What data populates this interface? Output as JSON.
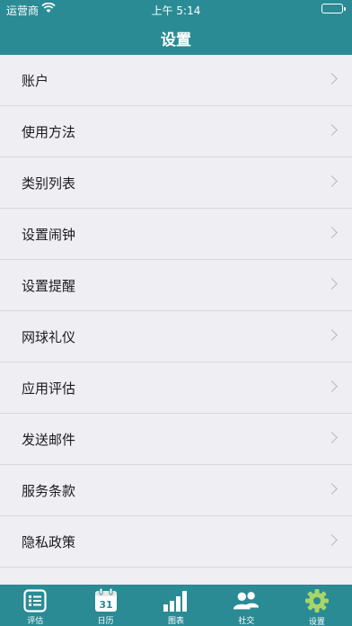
{
  "status_bar": {
    "carrier": "运营商",
    "time": "上午 5:14"
  },
  "nav": {
    "title": "设置"
  },
  "settings_items": [
    {
      "label": "账户"
    },
    {
      "label": "使用方法"
    },
    {
      "label": "类别列表"
    },
    {
      "label": "设置闹钟"
    },
    {
      "label": "设置提醒"
    },
    {
      "label": "网球礼仪"
    },
    {
      "label": "应用评估"
    },
    {
      "label": "发送邮件"
    },
    {
      "label": "服务条款"
    },
    {
      "label": "隐私政策"
    }
  ],
  "tab_bar": {
    "items": [
      {
        "label": "评估",
        "icon": "list-icon"
      },
      {
        "label": "日历",
        "icon": "calendar-icon",
        "calendar_day": "31"
      },
      {
        "label": "图表",
        "icon": "bar-chart-icon"
      },
      {
        "label": "社交",
        "icon": "people-icon"
      },
      {
        "label": "设置",
        "icon": "gear-icon"
      }
    ],
    "active_index": 4
  },
  "colors": {
    "theme": "#2a8b95",
    "background": "#eeeef3",
    "active_icon": "#a8d468",
    "icon": "#ffffff"
  }
}
